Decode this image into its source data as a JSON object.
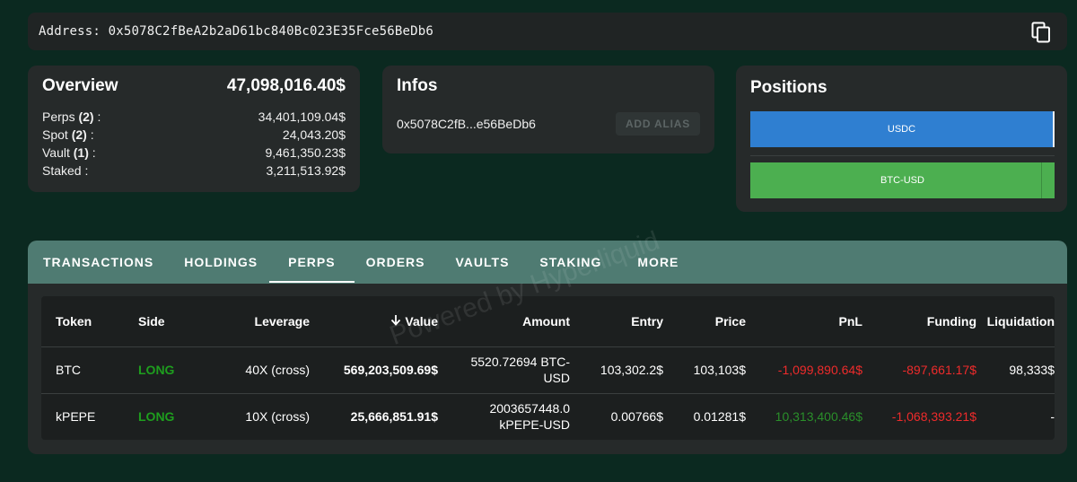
{
  "address_bar": {
    "label": "Address: 0x5078C2fBeA2b2aD61bc840Bc023E35Fce56BeDb6",
    "copy_icon": "copy-icon"
  },
  "overview": {
    "title": "Overview",
    "total": "47,098,016.40$",
    "rows": [
      {
        "label": "Perps",
        "count": "(2)",
        "suffix": " :",
        "value": "34,401,109.04$"
      },
      {
        "label": "Spot",
        "count": "(2)",
        "suffix": " :",
        "value": "24,043.20$"
      },
      {
        "label": "Vault",
        "count": "(1)",
        "suffix": " :",
        "value": "9,461,350.23$"
      },
      {
        "label": "Staked :",
        "count": "",
        "suffix": "",
        "value": "3,211,513.92$"
      }
    ]
  },
  "infos": {
    "title": "Infos",
    "short_address": "0x5078C2fB...e56BeDb6",
    "add_alias_label": "ADD ALIAS"
  },
  "positions": {
    "title": "Positions",
    "bars": [
      {
        "label": "USDC",
        "color": "#2f7fd1"
      },
      {
        "label": "BTC-USD",
        "color": "#4caf50"
      }
    ]
  },
  "tabs": [
    {
      "label": "TRANSACTIONS"
    },
    {
      "label": "HOLDINGS"
    },
    {
      "label": "PERPS",
      "active": true
    },
    {
      "label": "ORDERS"
    },
    {
      "label": "VAULTS"
    },
    {
      "label": "STAKING"
    },
    {
      "label": "MORE"
    }
  ],
  "table": {
    "columns": [
      "Token",
      "Side",
      "Leverage",
      "Value",
      "Amount",
      "Entry",
      "Price",
      "PnL",
      "Funding",
      "Liquidation"
    ],
    "sort_icon": "arrow-down-icon",
    "rows": [
      {
        "token": "BTC",
        "side": "LONG",
        "leverage": "40X (cross)",
        "value": "569,203,509.69$",
        "amount_line1": "5520.72694 BTC-",
        "amount_line2": "USD",
        "entry": "103,302.2$",
        "price": "103,103$",
        "pnl": "-1,099,890.64$",
        "funding": "-897,661.17$",
        "liquidation": "98,333$"
      },
      {
        "token": "kPEPE",
        "side": "LONG",
        "leverage": "10X (cross)",
        "value": "25,666,851.91$",
        "amount_line1": "2003657448.0",
        "amount_line2": "kPEPE-USD",
        "entry": "0.00766$",
        "price": "0.01281$",
        "pnl": "10,313,400.46$",
        "funding": "-1,068,393.21$",
        "liquidation": "-"
      }
    ]
  },
  "watermark": "Powered by Hyperliquid",
  "colors": {
    "background": "#0b2920",
    "card": "#262a2a",
    "tab_bar": "#4f7b72",
    "long": "#1e9e1e",
    "negative": "#ee2b2b",
    "positive": "#2a8f2a"
  }
}
